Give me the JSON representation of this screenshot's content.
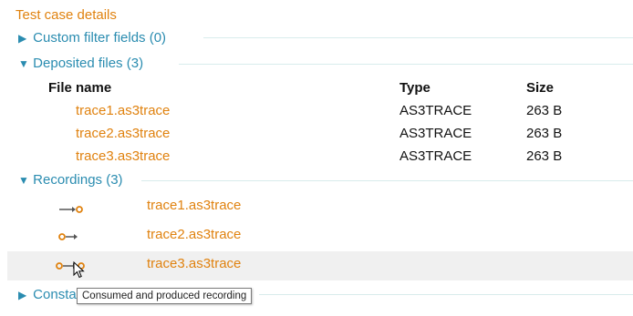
{
  "page": {
    "title": "Test case details"
  },
  "sections": {
    "custom_filter": {
      "label": "Custom filter fields (0)",
      "expanded": false
    },
    "deposited": {
      "label": "Deposited files (3)",
      "expanded": true
    },
    "recordings": {
      "label": "Recordings (3)",
      "expanded": true
    },
    "constants": {
      "label": "Consta",
      "expanded": false
    }
  },
  "files_table": {
    "headers": {
      "name": "File name",
      "type": "Type",
      "size": "Size"
    },
    "rows": [
      {
        "name": "trace1.as3trace",
        "type": "AS3TRACE",
        "size": "263 B"
      },
      {
        "name": "trace2.as3trace",
        "type": "AS3TRACE",
        "size": "263 B"
      },
      {
        "name": "trace3.as3trace",
        "type": "AS3TRACE",
        "size": "263 B"
      }
    ]
  },
  "recordings": [
    {
      "name": "trace1.as3trace",
      "icon": "produced-recording-icon"
    },
    {
      "name": "trace2.as3trace",
      "icon": "consumed-recording-icon"
    },
    {
      "name": "trace3.as3trace",
      "icon": "consumed-and-produced-recording-icon"
    }
  ],
  "tooltip": {
    "text": "Consumed and produced recording"
  },
  "colors": {
    "accent_orange": "#e0820f",
    "section_teal": "#2a8cb0",
    "separator": "#d8ecec",
    "hover_row": "#f0f0f0"
  }
}
